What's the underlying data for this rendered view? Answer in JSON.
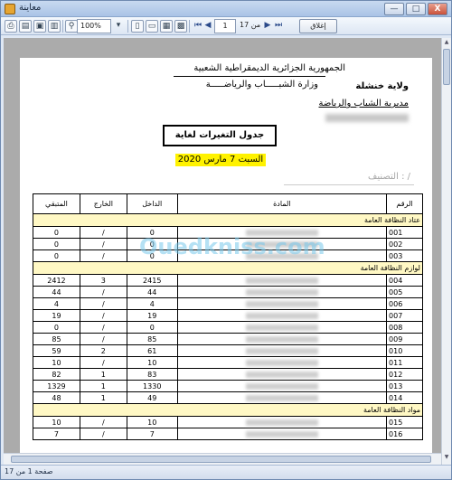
{
  "window": {
    "title": "معاينة",
    "minimize_label": "—",
    "maximize_label": "□",
    "close_label": "X"
  },
  "toolbar": {
    "zoom": "100%",
    "page_current": "1",
    "page_of": "من 17",
    "close_label": "إغلاق"
  },
  "report": {
    "header_line1": "الجمهورية الجزائرية الديمقراطية الشعبية",
    "header_line2": "وزارة الشبـــــاب والرياضـــــة",
    "left_line1": "ولاية خنشلة",
    "left_line2": "مديرية الشباب والرياضة",
    "box_title": "جدول التغيرات لغاية",
    "date": "السبت 7 مارس 2020",
    "classification": "التصنيف : /",
    "watermark": "Ouedkniss.com",
    "columns": {
      "remaining": "المتبقي",
      "out": "الخارج",
      "in": "الداخل",
      "item": "المادة",
      "number": "الرقم"
    },
    "groups": [
      {
        "label": "عتاد النظافة العامة",
        "rows": [
          {
            "remaining": "0",
            "out": "/",
            "in": "0",
            "number": "001"
          },
          {
            "remaining": "0",
            "out": "/",
            "in": "0",
            "number": "002"
          },
          {
            "remaining": "0",
            "out": "/",
            "in": "0",
            "number": "003"
          }
        ]
      },
      {
        "label": "لوازم النظافة العامة",
        "rows": [
          {
            "remaining": "2412",
            "out": "3",
            "in": "2415",
            "number": "004"
          },
          {
            "remaining": "44",
            "out": "/",
            "in": "44",
            "number": "005"
          },
          {
            "remaining": "4",
            "out": "/",
            "in": "4",
            "number": "006"
          },
          {
            "remaining": "19",
            "out": "/",
            "in": "19",
            "number": "007"
          },
          {
            "remaining": "0",
            "out": "/",
            "in": "0",
            "number": "008"
          },
          {
            "remaining": "85",
            "out": "/",
            "in": "85",
            "number": "009"
          },
          {
            "remaining": "59",
            "out": "2",
            "in": "61",
            "number": "010"
          },
          {
            "remaining": "10",
            "out": "/",
            "in": "10",
            "number": "011"
          },
          {
            "remaining": "82",
            "out": "1",
            "in": "83",
            "number": "012"
          },
          {
            "remaining": "1329",
            "out": "1",
            "in": "1330",
            "number": "013"
          },
          {
            "remaining": "48",
            "out": "1",
            "in": "49",
            "number": "014"
          }
        ]
      },
      {
        "label": "مواد النظافة العامة",
        "rows": [
          {
            "remaining": "10",
            "out": "/",
            "in": "10",
            "number": "015"
          },
          {
            "remaining": "7",
            "out": "/",
            "in": "7",
            "number": "016"
          }
        ]
      }
    ]
  },
  "status": {
    "text": "صفحة 1 من 17"
  }
}
